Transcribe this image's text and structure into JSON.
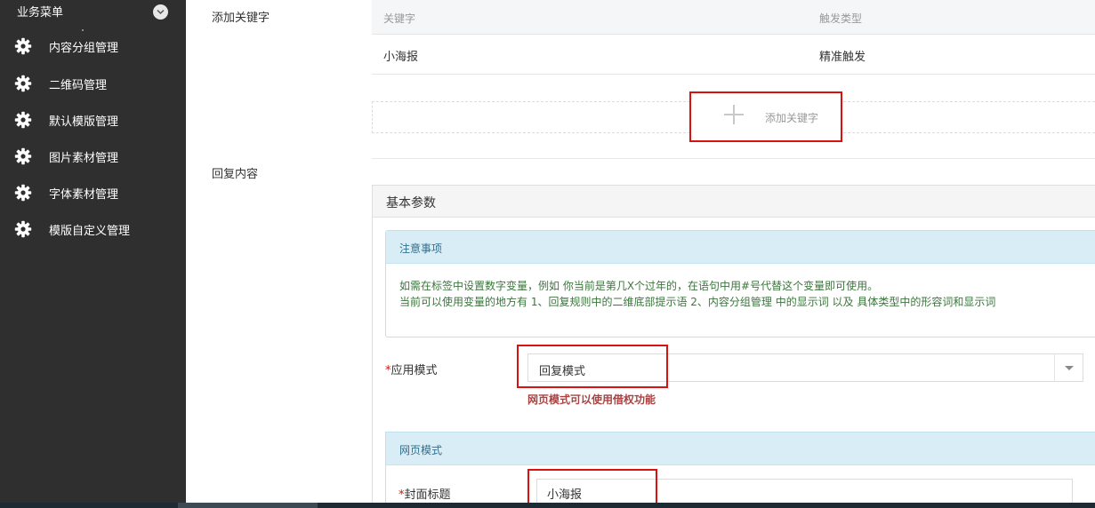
{
  "sidebar": {
    "title": "业务菜单",
    "toggle_icon": "chevron-down-icon",
    "items": [
      {
        "label": "内容分组管理",
        "icon": "gear-icon"
      },
      {
        "label": "二维码管理",
        "icon": "gear-icon"
      },
      {
        "label": "默认模版管理",
        "icon": "gear-icon"
      },
      {
        "label": "图片素材管理",
        "icon": "gear-icon"
      },
      {
        "label": "字体素材管理",
        "icon": "gear-icon"
      },
      {
        "label": "模版自定义管理",
        "icon": "gear-icon"
      }
    ]
  },
  "form": {
    "add_keyword_label": "添加关键字",
    "reply_content_label": "回复内容"
  },
  "keyword_table": {
    "columns": [
      "关键字",
      "触发类型"
    ],
    "rows": [
      {
        "keyword": "小海报",
        "trigger": "精准触发"
      }
    ],
    "add_button_label": "添加关键字"
  },
  "panel": {
    "title": "基本参数",
    "notice": {
      "title": "注意事项",
      "lines": [
        "如需在标签中设置数字变量，例如 你当前是第几X个过年的，在语句中用#号代替这个变量即可使用。",
        "当前可以使用变量的地方有 1、回复规则中的二维底部提示语 2、内容分组管理 中的显示词 以及 具体类型中的形容词和显示词"
      ]
    },
    "app_mode": {
      "required_mark": "*",
      "label": "应用模式",
      "value": "回复模式",
      "hint": "网页模式可以使用借权功能"
    },
    "web_mode": {
      "title": "网页模式",
      "cover_title": {
        "required_mark": "*",
        "label": "封面标题",
        "value": "小海报"
      }
    }
  },
  "colors": {
    "sidebar_bg": "#2f2f2f",
    "highlight_red": "#d9120f",
    "info_bg": "#d9edf7",
    "hint_text": "#a94442"
  }
}
